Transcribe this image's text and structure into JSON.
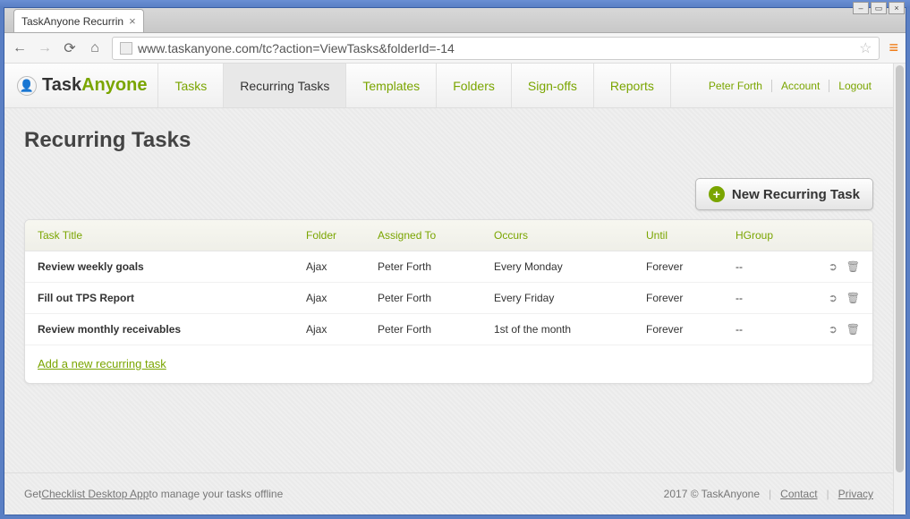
{
  "browser": {
    "tab_title": "TaskAnyone Recurrin",
    "url": "www.taskanyone.com/tc?action=ViewTasks&folderId=-14"
  },
  "logo": {
    "task": "Task",
    "anyone": "Anyone"
  },
  "nav": {
    "items": [
      {
        "label": "Tasks",
        "active": false
      },
      {
        "label": "Recurring Tasks",
        "active": true
      },
      {
        "label": "Templates",
        "active": false
      },
      {
        "label": "Folders",
        "active": false
      },
      {
        "label": "Sign-offs",
        "active": false
      },
      {
        "label": "Reports",
        "active": false
      }
    ]
  },
  "user_nav": {
    "user": "Peter Forth",
    "account": "Account",
    "logout": "Logout"
  },
  "page_title": "Recurring Tasks",
  "new_button": "New Recurring Task",
  "table": {
    "headers": {
      "title": "Task Title",
      "folder": "Folder",
      "assigned": "Assigned To",
      "occurs": "Occurs",
      "until": "Until",
      "hgroup": "HGroup"
    },
    "rows": [
      {
        "title": "Review weekly goals",
        "folder": "Ajax",
        "assigned": "Peter Forth",
        "occurs": "Every Monday",
        "until": "Forever",
        "hgroup": "--"
      },
      {
        "title": "Fill out TPS Report",
        "folder": "Ajax",
        "assigned": "Peter Forth",
        "occurs": "Every Friday",
        "until": "Forever",
        "hgroup": "--"
      },
      {
        "title": "Review monthly receivables",
        "folder": "Ajax",
        "assigned": "Peter Forth",
        "occurs": "1st of the month",
        "until": "Forever",
        "hgroup": "--"
      }
    ]
  },
  "add_link": "Add a new recurring task",
  "footer": {
    "left_pre": "Get ",
    "left_link": "Checklist Desktop App",
    "left_post": " to manage your tasks offline",
    "copyright": "2017 © TaskAnyone",
    "contact": "Contact",
    "privacy": "Privacy"
  }
}
